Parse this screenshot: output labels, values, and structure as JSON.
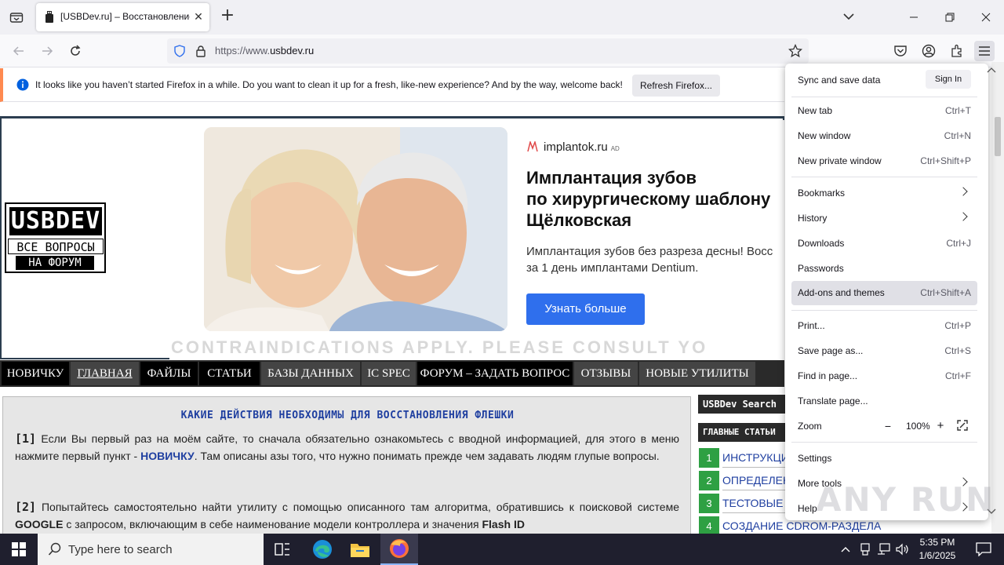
{
  "browser": {
    "tab_title": "[USBDev.ru] – Восстановление",
    "url_prefix": "https://www.",
    "url_domain": "usbdev.ru",
    "notification_text": "It looks like you haven’t started Firefox in a while. Do you want to clean it up for a fresh, like-new experience? And by the way, welcome back!",
    "notification_button": "Refresh Firefox..."
  },
  "ad": {
    "brand": "implantok.ru",
    "ad_badge": "AD",
    "headline_1": "Имплантация зубов",
    "headline_2": "по хирургическому шаблону",
    "headline_3": "Щёлковская",
    "desc_1": "Имплантация зубов без разреза десны! Восс",
    "desc_2": "за 1 день имплантами Dentium.",
    "cta": "Узнать больше",
    "disclaimer": "CONTRAINDICATIONS APPLY. PLEASE CONSULT YO"
  },
  "logo": {
    "top": "USBDEV",
    "mid": "ВСЕ ВОПРОСЫ",
    "bot": "НА ФОРУМ"
  },
  "site_menu": [
    "НОВИЧКУ",
    "ГЛАВНАЯ",
    "ФАЙЛЫ",
    "СТАТЬИ",
    "БАЗЫ ДАННЫХ",
    "IC SPEC",
    "ФОРУМ – ЗАДАТЬ ВОПРОС",
    "ОТЗЫВЫ",
    "НОВЫЕ УТИЛИТЫ"
  ],
  "article": {
    "title": "КАКИЕ ДЕЙСТВИЯ НЕОБХОДИМЫ ДЛЯ ВОССТАНОВЛЕНИЯ ФЛЕШКИ",
    "p1_num": "[1]",
    "p1_a": " Если Вы первый раз на моём сайте, то сначала обязательно ознакомьтесь с вводной информацией, для этого в меню нажмите первый пункт - ",
    "p1_link": "НОВИЧКУ",
    "p1_b": ". Там описаны азы того, что нужно понимать прежде чем задавать людям глупые вопросы.",
    "p2_num": "[2]",
    "p2_a": " Попытайтесь самостоятельно найти утилиту с помощью описанного там алгоритма, обратившись к поисковой системе ",
    "p2_google": "GOOGLE",
    "p2_b": " с запросом, включающим в себе наименование модели контроллера и значения ",
    "p2_flash": "Flash ID"
  },
  "sidebar": {
    "search_head": "USBDev Search",
    "main_head": "ГЛАВНЫЕ СТАТЬИ",
    "items": [
      {
        "num": "1",
        "text": "ИНСТРУКЦИЯ"
      },
      {
        "num": "2",
        "text": "ОПРЕДЕЛЕНИЕ"
      },
      {
        "num": "3",
        "text": "ТЕСТОВЫЕ"
      },
      {
        "num": "4",
        "text": "СОЗДАНИЕ CDROM-РАЗДЕЛА"
      }
    ]
  },
  "app_menu": {
    "sync": "Sync and save data",
    "sign_in": "Sign In",
    "items": [
      {
        "label": "New tab",
        "shortcut": "Ctrl+T"
      },
      {
        "label": "New window",
        "shortcut": "Ctrl+N"
      },
      {
        "label": "New private window",
        "shortcut": "Ctrl+Shift+P"
      },
      {
        "label": "Bookmarks",
        "shortcut": ""
      },
      {
        "label": "History",
        "shortcut": ""
      },
      {
        "label": "Downloads",
        "shortcut": "Ctrl+J"
      },
      {
        "label": "Passwords",
        "shortcut": ""
      },
      {
        "label": "Add-ons and themes",
        "shortcut": "Ctrl+Shift+A"
      },
      {
        "label": "Print...",
        "shortcut": "Ctrl+P"
      },
      {
        "label": "Save page as...",
        "shortcut": "Ctrl+S"
      },
      {
        "label": "Find in page...",
        "shortcut": "Ctrl+F"
      },
      {
        "label": "Translate page...",
        "shortcut": ""
      },
      {
        "label": "Zoom",
        "shortcut": ""
      },
      {
        "label": "Settings",
        "shortcut": ""
      },
      {
        "label": "More tools",
        "shortcut": ""
      },
      {
        "label": "Help",
        "shortcut": ""
      }
    ],
    "zoom_value": "100%",
    "zoom_minus": "−",
    "zoom_plus": "+"
  },
  "watermark": "ANY RUN",
  "taskbar": {
    "search_placeholder": "Type here to search",
    "time": "5:35 PM",
    "date": "1/6/2025"
  },
  "icons": {
    "tab_list": "tab-list-icon",
    "close": "close-icon",
    "new_tab": "plus-icon",
    "back": "back-arrow-icon",
    "forward": "forward-arrow-icon",
    "reload": "reload-icon",
    "shield": "tracking-shield-icon",
    "lock": "lock-icon",
    "bookmark_star": "star-icon",
    "pocket": "pocket-icon",
    "account": "account-icon",
    "extensions": "extensions-icon",
    "hamburger": "hamburger-menu-icon",
    "info": "info-icon"
  },
  "colors": {
    "accent_blue": "#2f6fed",
    "site_green": "#2ea043",
    "site_link": "#1f3fa0",
    "notification_stripe": "#ff8a50"
  }
}
